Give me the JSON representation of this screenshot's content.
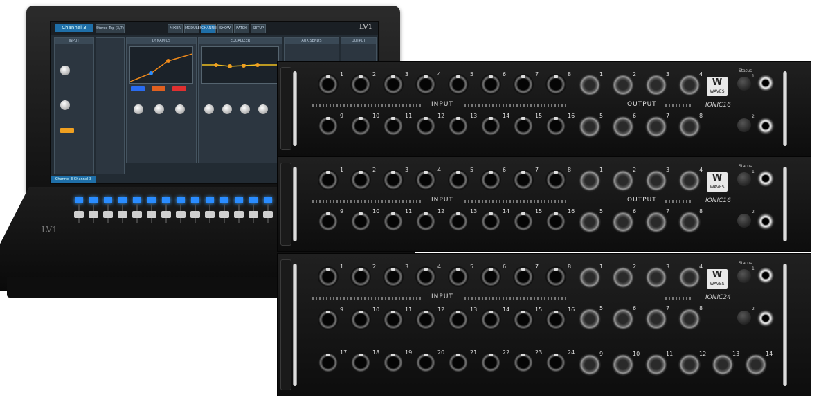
{
  "console": {
    "channel_label": "Channel 3",
    "preset": "Stereo Top (3/7)",
    "brand": "LV1",
    "footer": "Channel 3 Channel 3",
    "brand_small": "LV1",
    "tabs": [
      "MIXER",
      "MODULES",
      "CHANNEL",
      "SHOW",
      "PATCH",
      "SETUP"
    ],
    "panels": [
      "INPUT",
      "DYNAMICS",
      "EQUALIZER",
      "AUX SENDS",
      "OUTPUT"
    ],
    "fader_color": "#2a8cff"
  },
  "units": [
    {
      "model": "IONIC16",
      "input_label": "INPUT",
      "output_label": "OUTPUT",
      "status_label": "Status",
      "input_numbers": [
        "1",
        "2",
        "3",
        "4",
        "5",
        "6",
        "7",
        "8",
        "9",
        "10",
        "11",
        "12",
        "13",
        "14",
        "15",
        "16"
      ],
      "output_numbers": [
        "1",
        "2",
        "3",
        "4",
        "5",
        "6",
        "7",
        "8"
      ],
      "phones": [
        "1",
        "2"
      ]
    },
    {
      "model": "IONIC16",
      "input_label": "INPUT",
      "output_label": "OUTPUT",
      "status_label": "Status",
      "input_numbers": [
        "1",
        "2",
        "3",
        "4",
        "5",
        "6",
        "7",
        "8",
        "9",
        "10",
        "11",
        "12",
        "13",
        "14",
        "15",
        "16"
      ],
      "output_numbers": [
        "1",
        "2",
        "3",
        "4",
        "5",
        "6",
        "7",
        "8"
      ],
      "phones": [
        "1",
        "2"
      ]
    },
    {
      "model": "IONIC24",
      "input_label": "INPUT",
      "output_label": "",
      "status_label": "Status",
      "input_numbers": [
        "1",
        "2",
        "3",
        "4",
        "5",
        "6",
        "7",
        "8",
        "9",
        "10",
        "11",
        "12",
        "13",
        "14",
        "15",
        "16",
        "17",
        "18",
        "19",
        "20",
        "21",
        "22",
        "23",
        "24"
      ],
      "output_numbers": [
        "1",
        "2",
        "3",
        "4",
        "5",
        "6",
        "7",
        "8",
        "9",
        "10",
        "11",
        "12",
        "13",
        "14"
      ],
      "phones": [
        "1",
        "2"
      ]
    }
  ],
  "brand_logo": "WAVES"
}
